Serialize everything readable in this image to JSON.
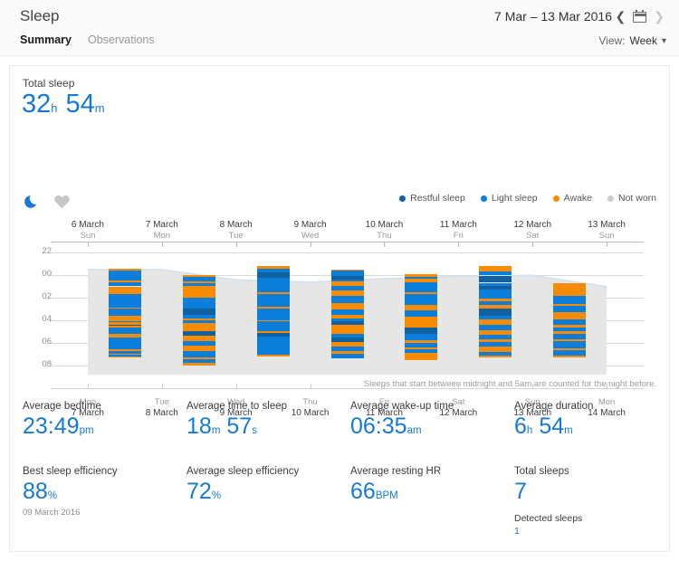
{
  "header": {
    "title": "Sleep",
    "date_range": "7 Mar – 13 Mar 2016",
    "prev_icon": "chevron-left-icon",
    "calendar_icon": "calendar-icon",
    "next_icon": "chevron-right-icon",
    "tabs": [
      {
        "label": "Summary",
        "active": true
      },
      {
        "label": "Observations",
        "active": false
      }
    ],
    "view": {
      "label": "View:",
      "value": "Week",
      "caret": "chevron-down-icon"
    }
  },
  "summary": {
    "total_sleep_label": "Total sleep",
    "total_hours": "32",
    "total_hours_unit": "h",
    "total_minutes": "54",
    "total_minutes_unit": "m",
    "moon_icon": "moon-icon",
    "heart_icon": "heart-icon"
  },
  "legend": [
    {
      "label": "Restful sleep",
      "color": "#11609f"
    },
    {
      "label": "Light sleep",
      "color": "#0b7ddb"
    },
    {
      "label": "Awake",
      "color": "#f98b00"
    },
    {
      "label": "Not worn",
      "color": "#cccccc"
    }
  ],
  "colors": {
    "accent": "#1779d6",
    "restful": "#11609f",
    "light": "#0b7ddb",
    "awake": "#f98b00",
    "notworn": "#cccccc",
    "band": "#e6e6e6",
    "bandline": "#cfe0ef"
  },
  "footnote": "Sleeps that start between midnight and 5am are counted for the night before.",
  "chart_data": {
    "type": "bar",
    "title": "",
    "xlabel": "",
    "ylabel": "",
    "grid": true,
    "legend_position": "top-right",
    "y_ticks": [
      "22",
      "00",
      "02",
      "04",
      "06",
      "08"
    ],
    "y_tick_hours": [
      22,
      24,
      26,
      28,
      30,
      32
    ],
    "ylim": [
      21.5,
      33.5
    ],
    "top_axis_labels": [
      {
        "date": "6 March",
        "weekday": "Sun"
      },
      {
        "date": "7 March",
        "weekday": "Mon"
      },
      {
        "date": "8 March",
        "weekday": "Tue"
      },
      {
        "date": "9 March",
        "weekday": "Wed"
      },
      {
        "date": "10 March",
        "weekday": "Thu"
      },
      {
        "date": "11 March",
        "weekday": "Fri"
      },
      {
        "date": "12 March",
        "weekday": "Sat"
      },
      {
        "date": "13 March",
        "weekday": "Sun"
      }
    ],
    "bottom_axis_labels": [
      {
        "weekday": "Mon",
        "date": "7 March"
      },
      {
        "weekday": "Tue",
        "date": "8 March"
      },
      {
        "weekday": "Wed",
        "date": "9 March"
      },
      {
        "weekday": "Thu",
        "date": "10 March"
      },
      {
        "weekday": "Fri",
        "date": "11 March"
      },
      {
        "weekday": "Sat",
        "date": "12 March"
      },
      {
        "weekday": "Sun",
        "date": "13 March"
      },
      {
        "weekday": "Mon",
        "date": "14 March"
      }
    ],
    "series_names": [
      "Restful sleep",
      "Light sleep",
      "Awake",
      "Not worn"
    ],
    "band": {
      "start_hour": 23.6,
      "end_hour": 32.8,
      "note": "average sleep window shading"
    },
    "bands_line_hours": [
      23.5,
      23.5,
      24.4,
      24.6,
      24.3,
      24.1,
      24.0,
      25.0
    ],
    "bars": [
      {
        "day": "7 March",
        "weekday": "Mon",
        "start_hour": 23.4,
        "end_hour": 31.3,
        "segments": [
          {
            "type": "awake",
            "h": 0.15
          },
          {
            "type": "light",
            "h": 0.95
          },
          {
            "type": "awake",
            "h": 0.12
          },
          {
            "type": "light",
            "h": 0.38
          },
          {
            "type": "awake",
            "h": 0.72
          },
          {
            "type": "light",
            "h": 1.15
          },
          {
            "type": "awake",
            "h": 0.12
          },
          {
            "type": "light",
            "h": 0.68
          },
          {
            "type": "awake",
            "h": 0.42
          },
          {
            "type": "light",
            "h": 0.12
          },
          {
            "type": "awake",
            "h": 0.22
          },
          {
            "type": "restful",
            "h": 0.1
          },
          {
            "type": "awake",
            "h": 0.18
          },
          {
            "type": "light",
            "h": 0.52
          },
          {
            "type": "awake",
            "h": 0.38
          },
          {
            "type": "light",
            "h": 1.05
          },
          {
            "type": "awake",
            "h": 0.16
          },
          {
            "type": "light",
            "h": 0.18
          },
          {
            "type": "awake",
            "h": 0.12
          },
          {
            "type": "light",
            "h": 0.14
          },
          {
            "type": "awake",
            "h": 0.14
          }
        ]
      },
      {
        "day": "8 March",
        "weekday": "Tue",
        "start_hour": 24.0,
        "end_hour": 32.0,
        "segments": [
          {
            "type": "awake",
            "h": 0.12
          },
          {
            "type": "light",
            "h": 0.42
          },
          {
            "type": "awake",
            "h": 0.14
          },
          {
            "type": "light",
            "h": 0.22
          },
          {
            "type": "awake",
            "h": 1.1
          },
          {
            "type": "light",
            "h": 0.95
          },
          {
            "type": "restful",
            "h": 0.55
          },
          {
            "type": "light",
            "h": 0.3
          },
          {
            "type": "awake",
            "h": 0.18
          },
          {
            "type": "light",
            "h": 0.22
          },
          {
            "type": "awake",
            "h": 0.7
          },
          {
            "type": "restful",
            "h": 0.42
          },
          {
            "type": "awake",
            "h": 0.48
          },
          {
            "type": "light",
            "h": 0.4
          },
          {
            "type": "awake",
            "h": 0.5
          },
          {
            "type": "light",
            "h": 0.55
          },
          {
            "type": "awake",
            "h": 0.2
          },
          {
            "type": "light",
            "h": 0.3
          },
          {
            "type": "awake",
            "h": 0.25
          }
        ]
      },
      {
        "day": "9 March",
        "weekday": "Wed",
        "start_hour": 23.2,
        "end_hour": 31.2,
        "segments": [
          {
            "type": "awake",
            "h": 0.22
          },
          {
            "type": "light",
            "h": 0.3
          },
          {
            "type": "restful",
            "h": 0.48
          },
          {
            "type": "light",
            "h": 1.3
          },
          {
            "type": "awake",
            "h": 0.16
          },
          {
            "type": "light",
            "h": 1.1
          },
          {
            "type": "awake",
            "h": 0.14
          },
          {
            "type": "light",
            "h": 1.05
          },
          {
            "type": "awake",
            "h": 0.14
          },
          {
            "type": "light",
            "h": 0.85
          },
          {
            "type": "awake",
            "h": 0.12
          },
          {
            "type": "restful",
            "h": 0.35
          },
          {
            "type": "light",
            "h": 1.6
          },
          {
            "type": "awake",
            "h": 0.19
          }
        ]
      },
      {
        "day": "10 March",
        "weekday": "Thu",
        "start_hour": 23.5,
        "end_hour": 31.3,
        "segments": [
          {
            "type": "awake",
            "h": 0.12
          },
          {
            "type": "light",
            "h": 0.48
          },
          {
            "type": "restful",
            "h": 0.3
          },
          {
            "type": "light",
            "h": 0.2
          },
          {
            "type": "awake",
            "h": 0.4
          },
          {
            "type": "light",
            "h": 0.35
          },
          {
            "type": "awake",
            "h": 0.55
          },
          {
            "type": "light",
            "h": 0.65
          },
          {
            "type": "awake",
            "h": 0.6
          },
          {
            "type": "light",
            "h": 0.45
          },
          {
            "type": "awake",
            "h": 0.3
          },
          {
            "type": "light",
            "h": 0.25
          },
          {
            "type": "restful",
            "h": 0.35
          },
          {
            "type": "awake",
            "h": 0.8
          },
          {
            "type": "light",
            "h": 0.35
          },
          {
            "type": "restful",
            "h": 0.45
          },
          {
            "type": "awake",
            "h": 0.35
          },
          {
            "type": "light",
            "h": 0.4
          },
          {
            "type": "awake",
            "h": 0.25
          },
          {
            "type": "light",
            "h": 0.4
          }
        ]
      },
      {
        "day": "11 March",
        "weekday": "Fri",
        "start_hour": 23.9,
        "end_hour": 31.5,
        "segments": [
          {
            "type": "awake",
            "h": 0.2
          },
          {
            "type": "light",
            "h": 0.22
          },
          {
            "type": "awake",
            "h": 0.3
          },
          {
            "type": "light",
            "h": 0.8
          },
          {
            "type": "awake",
            "h": 0.18
          },
          {
            "type": "light",
            "h": 0.95
          },
          {
            "type": "awake",
            "h": 0.45
          },
          {
            "type": "light",
            "h": 0.5
          },
          {
            "type": "awake",
            "h": 0.9
          },
          {
            "type": "restful",
            "h": 0.55
          },
          {
            "type": "light",
            "h": 0.55
          },
          {
            "type": "awake",
            "h": 0.25
          },
          {
            "type": "light",
            "h": 0.35
          },
          {
            "type": "awake",
            "h": 0.2
          },
          {
            "type": "light",
            "h": 0.25
          },
          {
            "type": "awake",
            "h": 0.65
          }
        ]
      },
      {
        "day": "12 March",
        "weekday": "Sat",
        "start_hour": 23.2,
        "end_hour": 31.3,
        "segments": [
          {
            "type": "awake",
            "h": 0.45
          },
          {
            "type": "light",
            "h": 0.32
          },
          {
            "type": "restful",
            "h": 0.6
          },
          {
            "type": "light",
            "h": 0.3
          },
          {
            "type": "restful",
            "h": 0.3
          },
          {
            "type": "light",
            "h": 0.75
          },
          {
            "type": "awake",
            "h": 0.16
          },
          {
            "type": "light",
            "h": 0.3
          },
          {
            "type": "awake",
            "h": 0.35
          },
          {
            "type": "restful",
            "h": 0.55
          },
          {
            "type": "light",
            "h": 0.35
          },
          {
            "type": "awake",
            "h": 0.45
          },
          {
            "type": "light",
            "h": 0.4
          },
          {
            "type": "awake",
            "h": 0.4
          },
          {
            "type": "light",
            "h": 0.35
          },
          {
            "type": "awake",
            "h": 0.25
          },
          {
            "type": "light",
            "h": 0.4
          },
          {
            "type": "awake",
            "h": 0.4
          },
          {
            "type": "light",
            "h": 0.3
          },
          {
            "type": "awake",
            "h": 0.22
          }
        ]
      },
      {
        "day": "13 March",
        "weekday": "Sun",
        "start_hour": 24.7,
        "end_hour": 31.3,
        "segments": [
          {
            "type": "awake",
            "h": 1.05
          },
          {
            "type": "light",
            "h": 0.7
          },
          {
            "type": "awake",
            "h": 0.18
          },
          {
            "type": "light",
            "h": 0.55
          },
          {
            "type": "awake",
            "h": 0.6
          },
          {
            "type": "light",
            "h": 0.45
          },
          {
            "type": "awake",
            "h": 0.2
          },
          {
            "type": "light",
            "h": 0.35
          },
          {
            "type": "awake",
            "h": 0.22
          },
          {
            "type": "light",
            "h": 0.4
          },
          {
            "type": "awake",
            "h": 0.22
          },
          {
            "type": "light",
            "h": 0.55
          },
          {
            "type": "awake",
            "h": 0.2
          },
          {
            "type": "light",
            "h": 0.45
          },
          {
            "type": "awake",
            "h": 0.18
          }
        ]
      }
    ]
  },
  "stats": {
    "row1": [
      {
        "label": "Average bedtime",
        "value": "23:49",
        "unit": "pm"
      },
      {
        "label": "Average time to sleep",
        "value": "18",
        "unit": "m",
        "value2": "57",
        "unit2": "s"
      },
      {
        "label": "Average wake-up time",
        "value": "06:35",
        "unit": "am"
      },
      {
        "label": "Average duration",
        "value": "6",
        "unit": "h",
        "value2": "54",
        "unit2": "m"
      }
    ],
    "row2": [
      {
        "label": "Best sleep efficiency",
        "value": "88",
        "unit": "%",
        "sub": "09 March 2016"
      },
      {
        "label": "Average sleep efficiency",
        "value": "72",
        "unit": "%"
      },
      {
        "label": "Average resting HR",
        "value": "66",
        "unit": "BPM"
      },
      {
        "label": "Total sleeps",
        "value": "7",
        "sublabel": "Detected sleeps",
        "subvalue": "1"
      }
    ]
  }
}
